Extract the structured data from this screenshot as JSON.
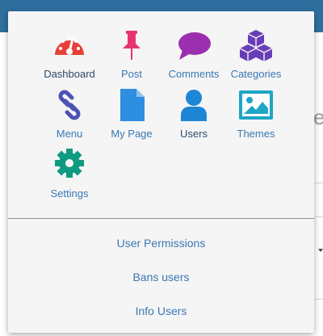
{
  "menu": {
    "apps": [
      {
        "label": "Dashboard",
        "icon": "dashboard-gauge-icon",
        "color": "#e8403a"
      },
      {
        "label": "Post",
        "icon": "pushpin-icon",
        "color": "#e8336e"
      },
      {
        "label": "Comments",
        "icon": "speech-bubble-icon",
        "color": "#9b2fb0"
      },
      {
        "label": "Categories",
        "icon": "cubes-icon",
        "color": "#6a3db8"
      },
      {
        "label": "Menu",
        "icon": "link-chain-icon",
        "color": "#4b52b8"
      },
      {
        "label": "My Page",
        "icon": "document-icon",
        "color": "#2e8ee0"
      },
      {
        "label": "Users",
        "icon": "user-icon",
        "color": "#1f86d6"
      },
      {
        "label": "Themes",
        "icon": "image-icon",
        "color": "#1ea6c4"
      },
      {
        "label": "Settings",
        "icon": "gear-icon",
        "color": "#0f9b82"
      }
    ],
    "links": [
      {
        "label": "User Permissions"
      },
      {
        "label": "Bans users"
      },
      {
        "label": "Info Users"
      }
    ]
  },
  "colors": {
    "link": "#3a78b2",
    "header": "#2f6f9f",
    "popup_bg": "#f5f5f5"
  }
}
